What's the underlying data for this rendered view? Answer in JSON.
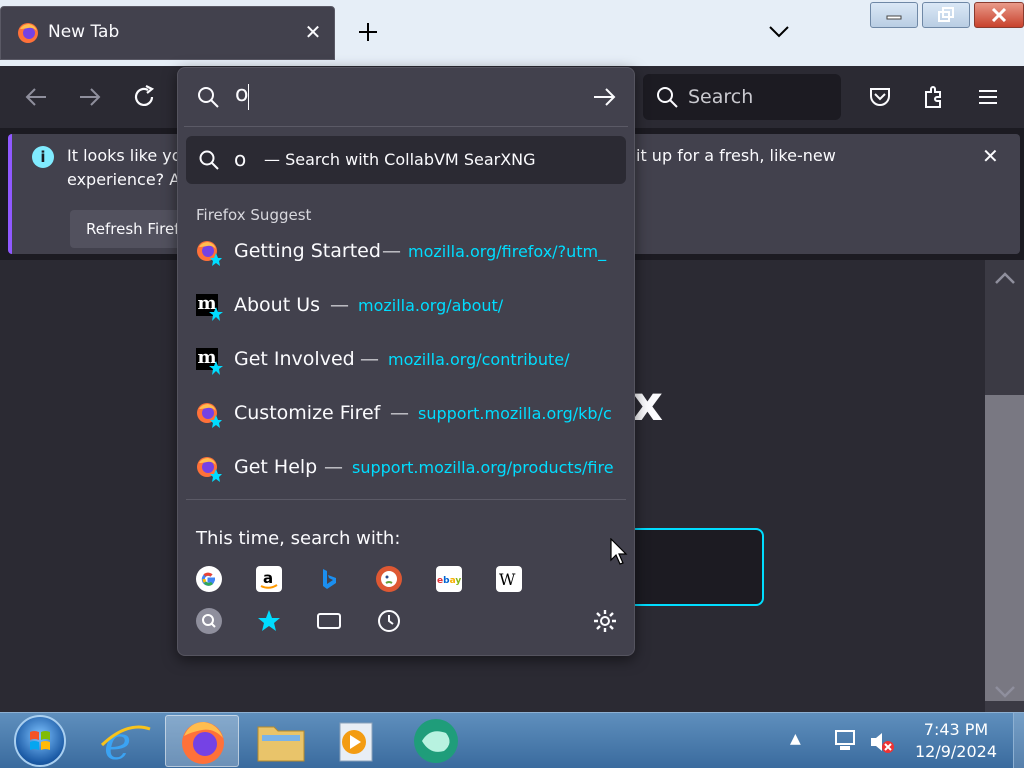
{
  "browser": {
    "tab": {
      "title": "New Tab",
      "close_glyph": "✕"
    },
    "newtab_icon": "plus-icon",
    "tablist_icon": "chevron-down-icon"
  },
  "toolbar": {
    "search_placeholder": "Search"
  },
  "urlbar": {
    "value": "o",
    "go_icon": "arrow-right-icon"
  },
  "dropdown": {
    "search_row": {
      "query": "o",
      "hint": "— Search with CollabVM SearXNG"
    },
    "group_label": "Firefox Suggest",
    "suggestions": [
      {
        "title": "Getting Started",
        "sep": "—",
        "url": "mozilla.org/firefox/?utm_",
        "icon": "firefox-icon"
      },
      {
        "title": "About Us",
        "sep": "—",
        "url": "mozilla.org/about/",
        "icon": "mozilla-m-icon"
      },
      {
        "title": "Get Involved",
        "sep": "—",
        "url": "mozilla.org/contribute/",
        "icon": "mozilla-m-icon"
      },
      {
        "title": "Customize Firef",
        "sep": "—",
        "url": "support.mozilla.org/kb/c",
        "icon": "firefox-icon"
      },
      {
        "title": "Get Help",
        "sep": "—",
        "url": "support.mozilla.org/products/fire",
        "icon": "firefox-icon"
      }
    ],
    "search_with_label": "This time, search with:",
    "engines": [
      "google-icon",
      "amazon-icon",
      "bing-icon",
      "duckduckgo-icon",
      "ebay-icon",
      "wikipedia-icon"
    ],
    "modes": [
      "searxng-icon",
      "bookmarks-star-icon",
      "tabs-icon",
      "history-clock-icon"
    ],
    "settings_icon": "gear-icon"
  },
  "notification": {
    "line1_start": "It looks like yo",
    "line1_end": "it up for a fresh, like-new",
    "line2": "experience? A",
    "button": "Refresh Firef"
  },
  "page": {
    "brand_fragment": "x"
  },
  "taskbar": {
    "time": "7:43 PM",
    "date": "12/9/2024"
  },
  "colors": {
    "accent": "#00ddff",
    "panel": "#42414d",
    "toolbar": "#2b2a33"
  }
}
